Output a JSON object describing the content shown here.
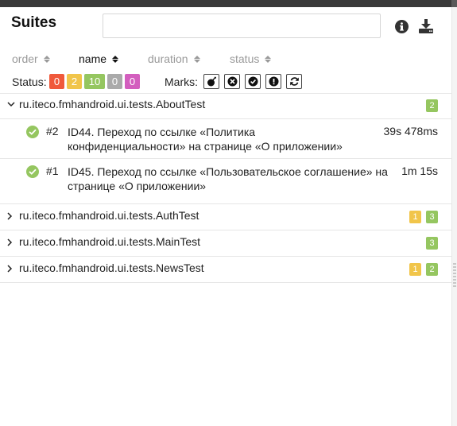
{
  "header": {
    "title": "Suites",
    "search": {
      "value": "",
      "placeholder": ""
    }
  },
  "icons": {
    "info": "info-circle-icon",
    "download": "download-icon"
  },
  "sort": {
    "columns": [
      {
        "label": "order",
        "active": false
      },
      {
        "label": "name",
        "active": true
      },
      {
        "label": "duration",
        "active": false
      },
      {
        "label": "status",
        "active": false
      }
    ]
  },
  "status_filter": {
    "label": "Status:",
    "counts": [
      {
        "name": "failed",
        "value": "0",
        "color": "#f0593b"
      },
      {
        "name": "broken",
        "value": "2",
        "color": "#f1c54a"
      },
      {
        "name": "passed",
        "value": "10",
        "color": "#95c660"
      },
      {
        "name": "skipped",
        "value": "0",
        "color": "#aaaaaa"
      },
      {
        "name": "unknown",
        "value": "0",
        "color": "#d35ebe"
      }
    ]
  },
  "marks": {
    "label": "Marks:",
    "items": [
      "bomb-icon",
      "times-circle-icon",
      "check-circle-icon",
      "exclamation-circle-icon",
      "refresh-icon"
    ]
  },
  "suites": [
    {
      "name": "ru.iteco.fmhandroid.ui.tests.AboutTest",
      "expanded": true,
      "counts": {
        "passed": "2"
      },
      "tests": [
        {
          "number": "#2",
          "name_lines": [
            "ID44. Переход по ссылке «Политика",
            "конфиденциальности» на странице «О приложении»"
          ],
          "duration": "39s 478ms",
          "status": "passed"
        },
        {
          "number": "#1",
          "name_lines": [
            "ID45. Переход по ссылке «Пользовательское соглашение» на",
            "странице «О приложении»"
          ],
          "duration": "1m 15s",
          "status": "passed"
        }
      ]
    },
    {
      "name": "ru.iteco.fmhandroid.ui.tests.AuthTest",
      "expanded": false,
      "counts": {
        "broken": "1",
        "passed": "3"
      }
    },
    {
      "name": "ru.iteco.fmhandroid.ui.tests.MainTest",
      "expanded": false,
      "counts": {
        "passed": "3"
      }
    },
    {
      "name": "ru.iteco.fmhandroid.ui.tests.NewsTest",
      "expanded": false,
      "counts": {
        "broken": "1",
        "passed": "2"
      }
    }
  ]
}
